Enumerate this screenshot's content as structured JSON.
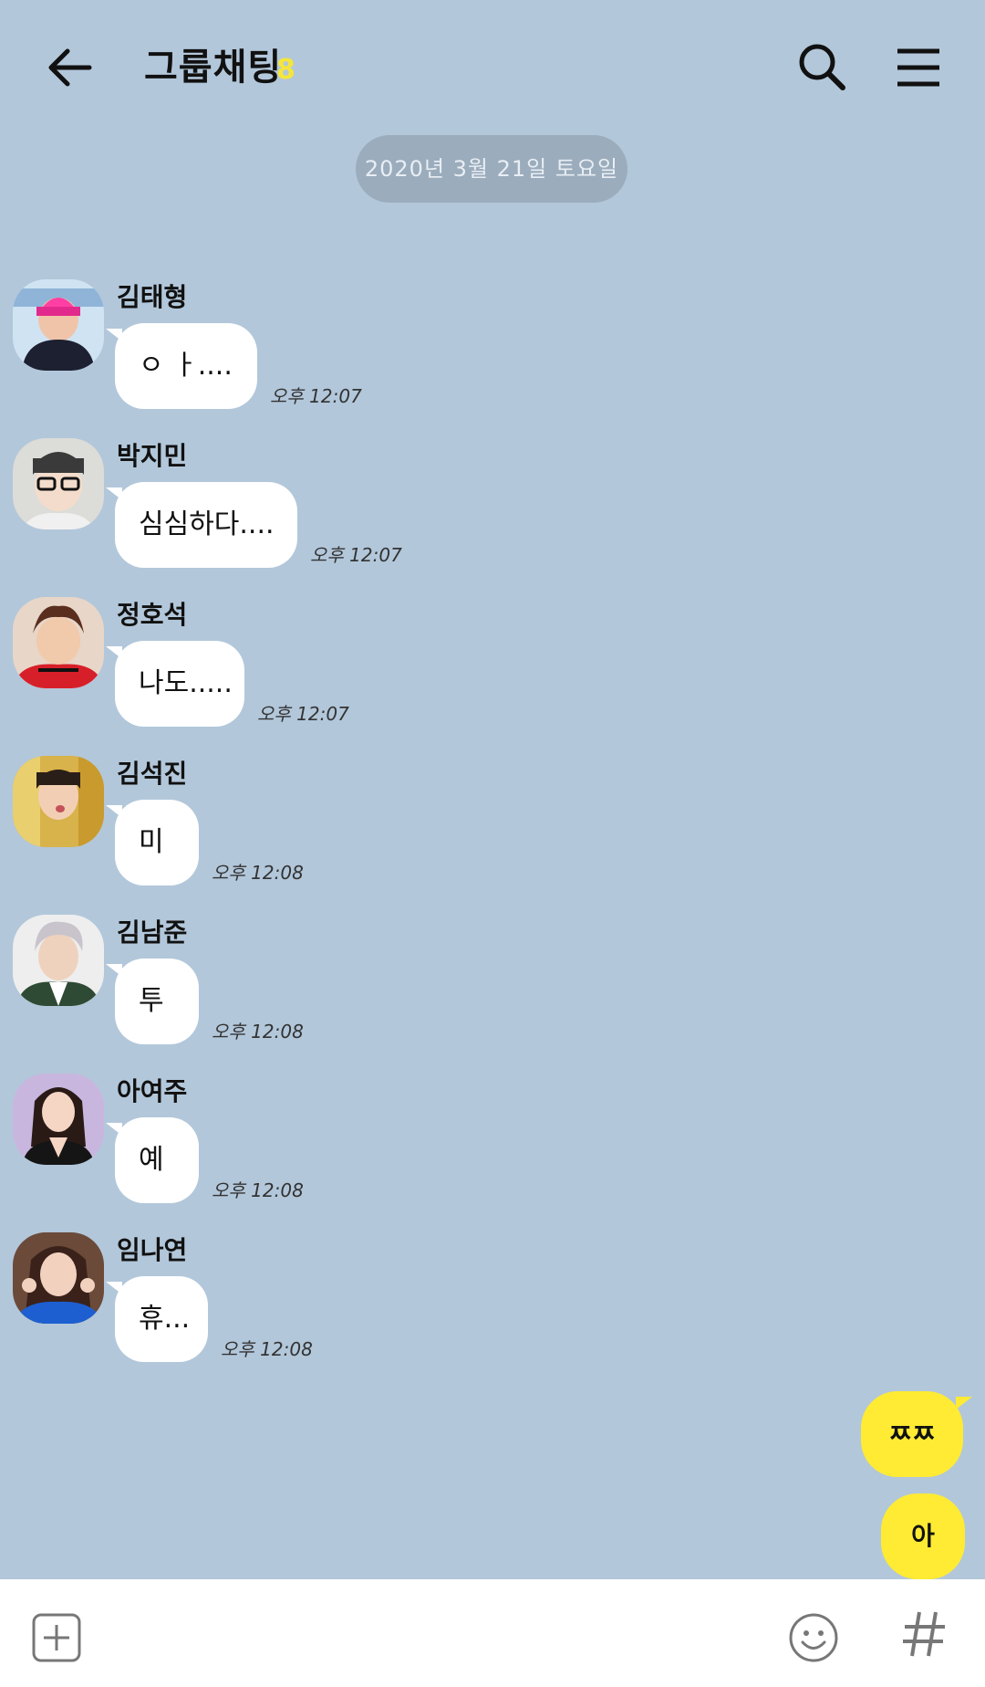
{
  "header": {
    "title": "그룹채팅",
    "member_count": "8"
  },
  "date_divider": "2020년 3월 21일 토요일",
  "messages": [
    {
      "sender": "김태형",
      "text": "ㅇ ㅏ....",
      "time": "오후 12:07"
    },
    {
      "sender": "박지민",
      "text": "심심하다....",
      "time": "오후 12:07"
    },
    {
      "sender": "정호석",
      "text": "나도.....",
      "time": "오후 12:07"
    },
    {
      "sender": "김석진",
      "text": "미",
      "time": "오후 12:08"
    },
    {
      "sender": "김남준",
      "text": "투",
      "time": "오후 12:08"
    },
    {
      "sender": "아여주",
      "text": "예",
      "time": "오후 12:08"
    },
    {
      "sender": "임나연",
      "text": "휴...",
      "time": "오후 12:08"
    }
  ],
  "my_messages": [
    {
      "text": "ㅉㅉ"
    },
    {
      "text": "아"
    }
  ],
  "colors": {
    "background": "#b2c7da",
    "my_bubble": "#ffeb33",
    "other_bubble": "#ffffff"
  },
  "icons": {
    "back": "back-arrow-icon",
    "search": "search-icon",
    "menu": "hamburger-menu-icon",
    "add": "plus-square-icon",
    "emoji": "smiley-icon",
    "hashtag": "hashtag-icon"
  }
}
